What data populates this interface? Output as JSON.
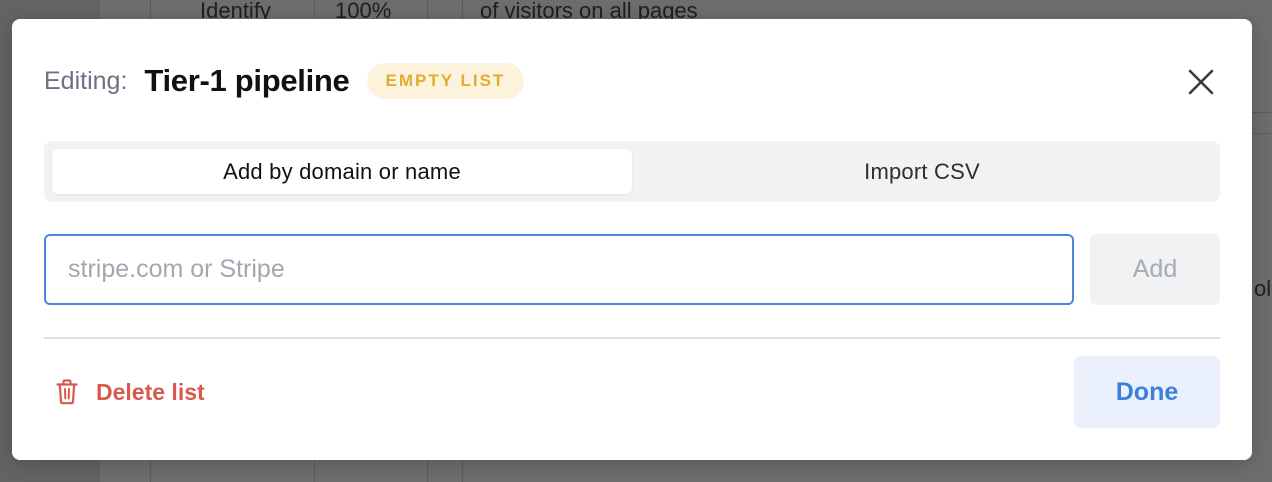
{
  "background": {
    "cell_1": "Identify",
    "cell_2": "100%",
    "cell_3": "of visitors on all pages",
    "cell_right": "ol"
  },
  "modal": {
    "editing_label": "Editing:",
    "list_name": "Tier-1 pipeline",
    "status_badge": "EMPTY LIST",
    "close_icon": "close-x-icon"
  },
  "tabs": [
    {
      "label": "Add by domain or name",
      "active": true
    },
    {
      "label": "Import CSV",
      "active": false
    }
  ],
  "domain_input": {
    "value": "",
    "placeholder": "stripe.com or Stripe"
  },
  "add_button": {
    "label": "Add",
    "disabled": true
  },
  "footer": {
    "delete_label": "Delete list",
    "delete_icon": "trash-icon",
    "done_label": "Done"
  },
  "colors": {
    "badge_bg": "#fdf3dc",
    "badge_text": "#e0ad33",
    "input_border": "#4a86e0",
    "delete": "#d9594c",
    "done_text": "#3f7fdc",
    "done_bg": "#eaf1fc"
  }
}
